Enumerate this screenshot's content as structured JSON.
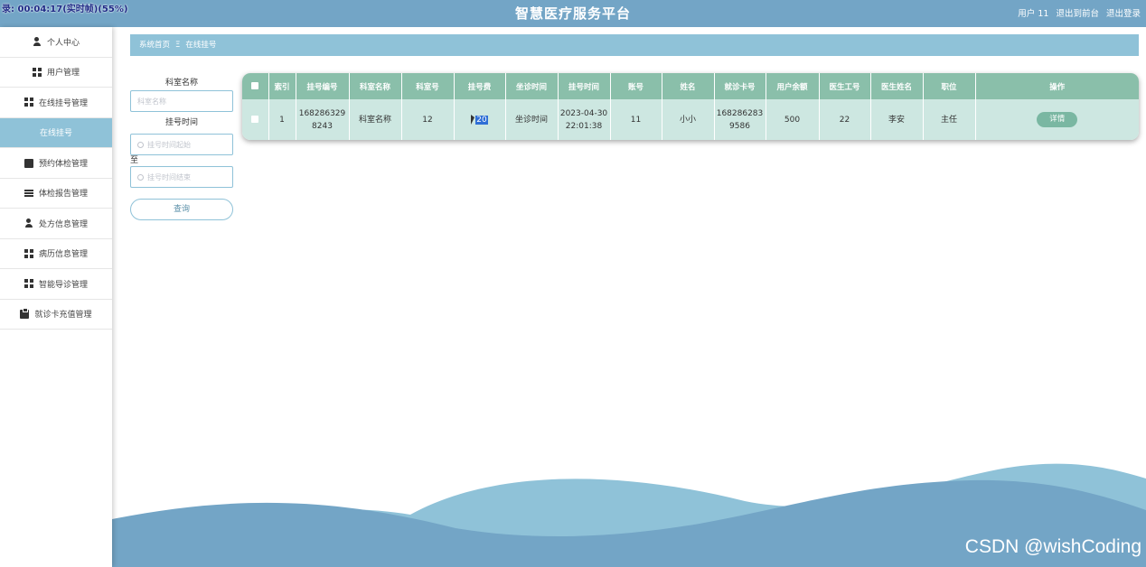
{
  "recording_overlay": "录: 00:04:17(实时帧)(55%)",
  "header": {
    "title": "智慧医疗服务平台",
    "user_label": "用户 11",
    "front_label": "退出到前台",
    "logout_label": "退出登录"
  },
  "sidebar": {
    "items": [
      {
        "label": "个人中心",
        "icon": "user-icon"
      },
      {
        "label": "用户管理",
        "icon": "grid-icon"
      },
      {
        "label": "在线挂号管理",
        "icon": "grid-icon"
      },
      {
        "label": "在线挂号",
        "icon": "",
        "active": true
      },
      {
        "label": "预约体检管理",
        "icon": "chat-icon"
      },
      {
        "label": "体检报告管理",
        "icon": "list-icon"
      },
      {
        "label": "处方信息管理",
        "icon": "user-icon"
      },
      {
        "label": "病历信息管理",
        "icon": "grid-icon"
      },
      {
        "label": "智能导诊管理",
        "icon": "grid-icon"
      },
      {
        "label": "就诊卡充值管理",
        "icon": "clipboard-icon"
      }
    ]
  },
  "breadcrumb": {
    "home": "系统首页",
    "separator": "Ξ",
    "current": "在线挂号"
  },
  "search": {
    "dept_label": "科室名称",
    "dept_placeholder": "科室名称",
    "time_label": "挂号时间",
    "start_placeholder": "挂号时间起始",
    "to_label": "至",
    "end_placeholder": "挂号时间结束",
    "query_label": "查询"
  },
  "table": {
    "headers": [
      "索引",
      "挂号编号",
      "科室名称",
      "科室号",
      "挂号费",
      "坐诊时间",
      "挂号时间",
      "账号",
      "姓名",
      "就诊卡号",
      "用户余额",
      "医生工号",
      "医生姓名",
      "职位",
      "操作"
    ],
    "rows": [
      {
        "index": "1",
        "reg_no": "1682863298243",
        "dept_name": "科室名称",
        "dept_no": "12",
        "fee": "20",
        "clinic_time": "坐诊时间",
        "reg_time": "2023-04-30 22:01:38",
        "account": "11",
        "name": "小小",
        "card_no": "1682862839586",
        "balance": "500",
        "doctor_id": "22",
        "doctor_name": "李安",
        "position": "主任",
        "action": "详情"
      }
    ]
  },
  "watermark": "CSDN @wishCoding",
  "colors": {
    "header_bg": "#73a5c6",
    "accent": "#8fc2d8",
    "table_header": "#8abfaa",
    "table_row": "#cde7e1",
    "detail_button": "#7ab7a2"
  }
}
